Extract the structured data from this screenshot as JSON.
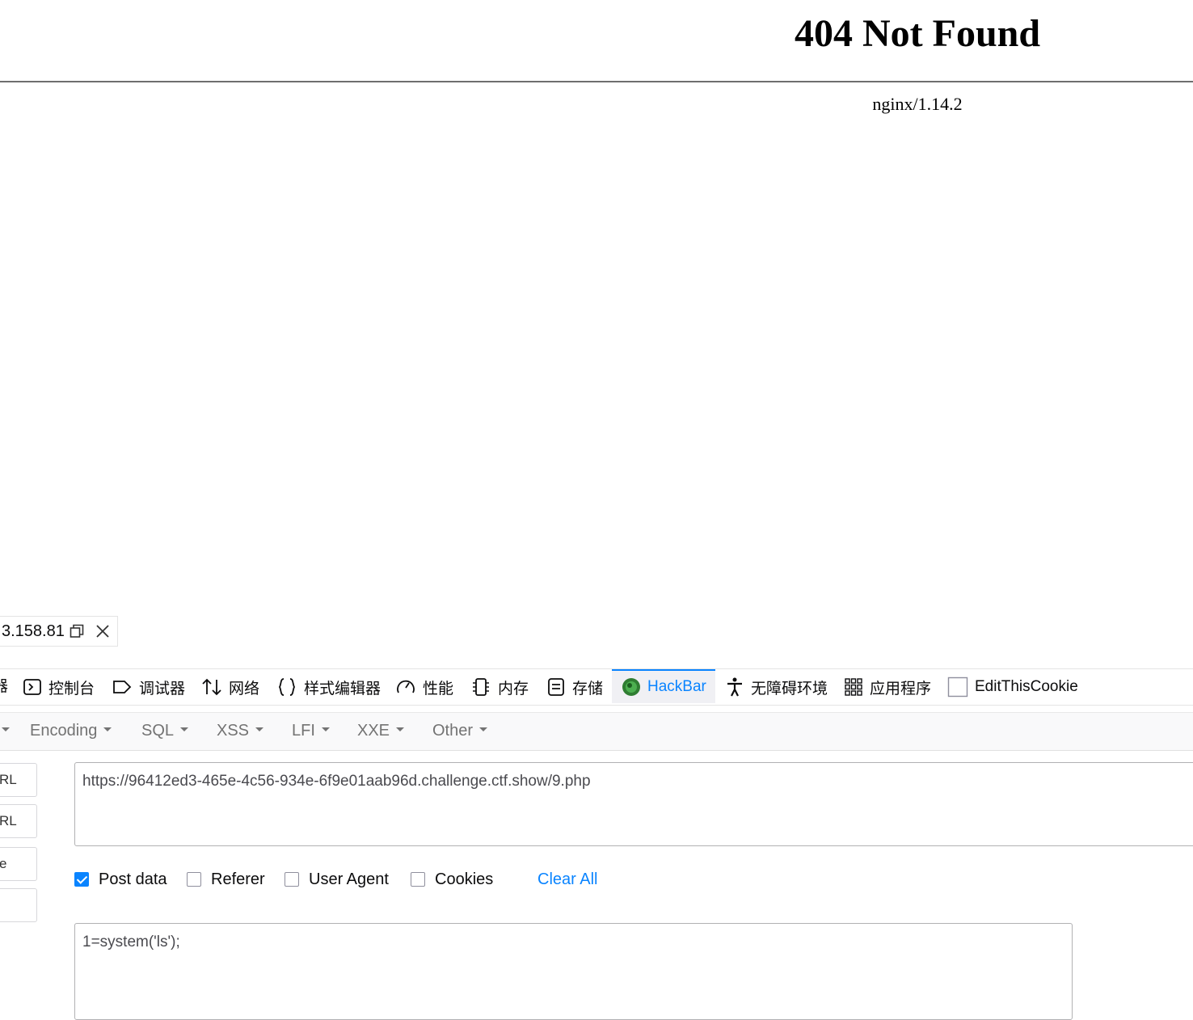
{
  "page": {
    "title": "404 Not Found",
    "server": "nginx/1.14.2"
  },
  "devtools": {
    "host_fragment": "3.158.81",
    "tabs": [
      {
        "label": "控制台",
        "icon": "console-icon"
      },
      {
        "label": "调试器",
        "icon": "debugger-icon"
      },
      {
        "label": "网络",
        "icon": "network-icon"
      },
      {
        "label": "样式编辑器",
        "icon": "style-editor-icon"
      },
      {
        "label": "性能",
        "icon": "performance-icon"
      },
      {
        "label": "内存",
        "icon": "memory-icon"
      },
      {
        "label": "存储",
        "icon": "storage-icon"
      },
      {
        "label": "HackBar",
        "icon": "hackbar-icon",
        "active": true
      },
      {
        "label": "无障碍环境",
        "icon": "accessibility-icon"
      },
      {
        "label": "应用程序",
        "icon": "application-icon"
      },
      {
        "label": "EditThisCookie",
        "icon": "cookie-icon"
      }
    ]
  },
  "hackbar": {
    "menus": [
      "Encoding",
      "SQL",
      "XSS",
      "LFI",
      "XXE",
      "Other"
    ],
    "side_buttons": [
      "RL",
      "RL",
      "e",
      ""
    ],
    "url": "https://96412ed3-465e-4c56-934e-6f9e01aab96d.challenge.ctf.show/9.php",
    "options": [
      {
        "label": "Post data",
        "checked": true
      },
      {
        "label": "Referer",
        "checked": false
      },
      {
        "label": "User Agent",
        "checked": false
      },
      {
        "label": "Cookies",
        "checked": false
      }
    ],
    "clear_all": "Clear All",
    "post_data": "1=system('ls');"
  },
  "colors": {
    "accent": "#0a84ff",
    "menu_text": "#737373",
    "active_tab_bg": "#f0f0f4"
  }
}
